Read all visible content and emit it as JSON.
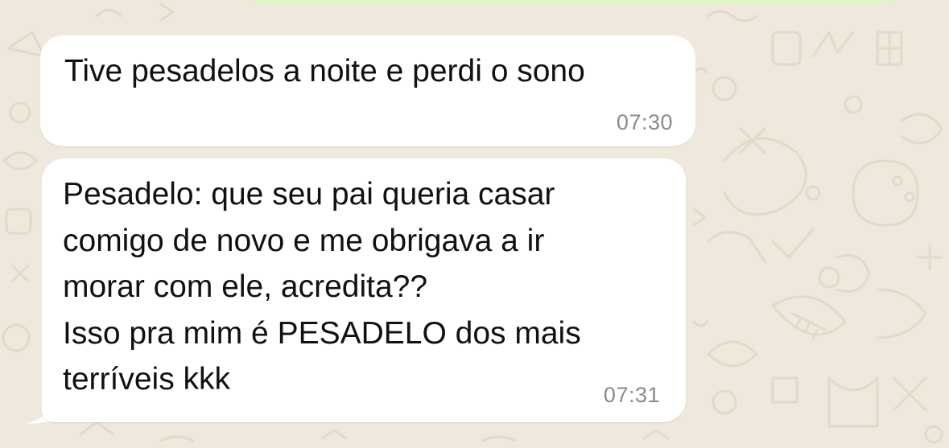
{
  "chat": {
    "messages": [
      {
        "text": "Tive pesadelos a noite e perdi o sono",
        "time": "07:30"
      },
      {
        "text": "Pesadelo: que seu pai queria casar\ncomigo de novo e me obrigava a ir\nmorar com ele, acredita??\nIsso pra mim é PESADELO dos mais\nterríveis kkk",
        "time": "07:31"
      }
    ]
  },
  "colors": {
    "wallpaper": "#efe8dd",
    "bubble_incoming": "#ffffff",
    "bubble_outgoing": "#dcf7c5",
    "text": "#111111",
    "timestamp": "#8a8a8a"
  }
}
